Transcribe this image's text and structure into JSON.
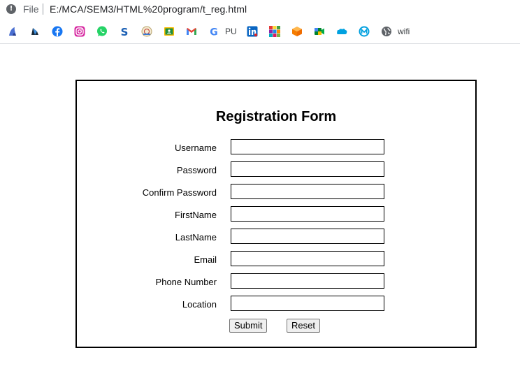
{
  "address_bar": {
    "scheme_label": "File",
    "url": "E:/MCA/SEM3/HTML%20program/t_reg.html"
  },
  "bookmarks": [
    {
      "icon": "bird-icon",
      "label": ""
    },
    {
      "icon": "dark-logo-icon",
      "label": ""
    },
    {
      "icon": "facebook-icon",
      "label": ""
    },
    {
      "icon": "instagram-icon",
      "label": ""
    },
    {
      "icon": "whatsapp-icon",
      "label": ""
    },
    {
      "icon": "s-logo-icon",
      "label": ""
    },
    {
      "icon": "emblem-icon",
      "label": ""
    },
    {
      "icon": "classroom-icon",
      "label": ""
    },
    {
      "icon": "gmail-icon",
      "label": ""
    },
    {
      "icon": "google-icon",
      "label": "PU"
    },
    {
      "icon": "linkedin-icon",
      "label": ""
    },
    {
      "icon": "grid-logo-icon",
      "label": ""
    },
    {
      "icon": "cube-icon",
      "label": ""
    },
    {
      "icon": "meet-icon",
      "label": ""
    },
    {
      "icon": "salesforce-icon",
      "label": ""
    },
    {
      "icon": "mulesoft-icon",
      "label": ""
    },
    {
      "icon": "globe-icon",
      "label": "wifi"
    }
  ],
  "form": {
    "title": "Registration Form",
    "fields": [
      {
        "label": "Username",
        "value": ""
      },
      {
        "label": "Password",
        "value": ""
      },
      {
        "label": "Confirm Password",
        "value": ""
      },
      {
        "label": "FirstName",
        "value": ""
      },
      {
        "label": "LastName",
        "value": ""
      },
      {
        "label": "Email",
        "value": ""
      },
      {
        "label": "Phone Number",
        "value": ""
      },
      {
        "label": "Location",
        "value": ""
      }
    ],
    "submit_label": "Submit",
    "reset_label": "Reset"
  }
}
